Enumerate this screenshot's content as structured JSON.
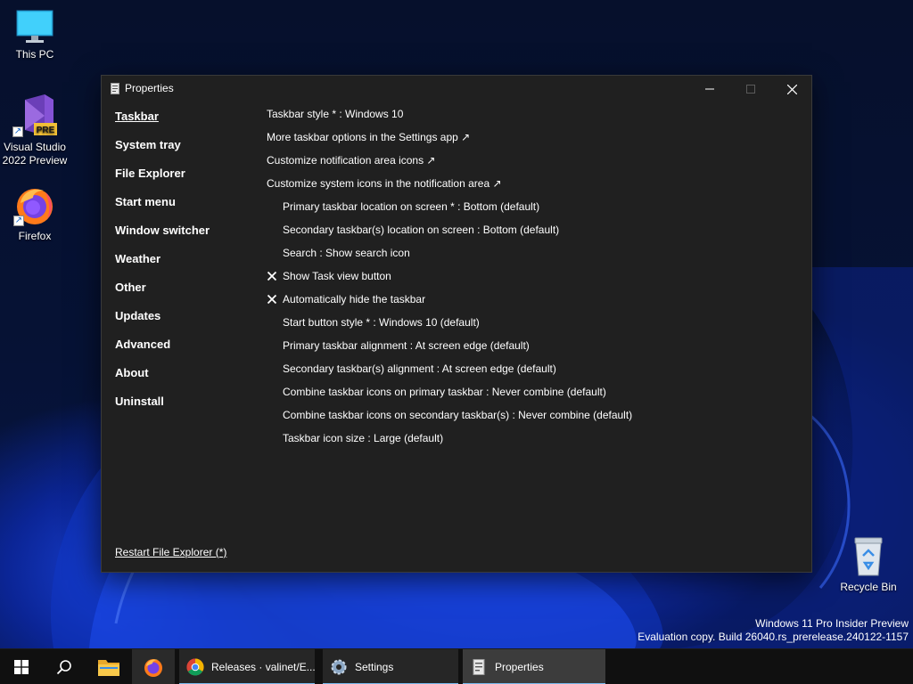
{
  "desktop": {
    "icons": [
      {
        "label": "This PC",
        "icon": "monitor-icon"
      },
      {
        "label": "Visual Studio 2022 Preview",
        "icon": "visual-studio-icon",
        "badge": "PRE"
      },
      {
        "label": "Firefox",
        "icon": "firefox-icon"
      },
      {
        "label": "Recycle Bin",
        "icon": "recycle-bin-icon"
      }
    ],
    "watermark": {
      "line1": "Windows 11 Pro Insider Preview",
      "line2": "Evaluation copy. Build 26040.rs_prerelease.240122-1157"
    }
  },
  "window": {
    "title": "Properties",
    "sidebar": {
      "items": [
        {
          "label": "Taskbar",
          "active": true
        },
        {
          "label": "System tray"
        },
        {
          "label": "File Explorer"
        },
        {
          "label": "Start menu"
        },
        {
          "label": "Window switcher"
        },
        {
          "label": "Weather"
        },
        {
          "label": "Other"
        },
        {
          "label": "Updates"
        },
        {
          "label": "Advanced"
        },
        {
          "label": "About"
        },
        {
          "label": "Uninstall"
        }
      ],
      "restart_label": "Restart File Explorer (*)"
    },
    "settings": [
      {
        "text": "Taskbar style * : Windows 10"
      },
      {
        "text": "More taskbar options in the Settings app ↗"
      },
      {
        "text": "Customize notification area icons ↗"
      },
      {
        "text": "Customize system icons in the notification area ↗"
      },
      {
        "text": "Primary taskbar location on screen * : Bottom (default)"
      },
      {
        "text": "Secondary taskbar(s) location on screen : Bottom (default)"
      },
      {
        "text": "Search : Show search icon"
      },
      {
        "text": "Show Task view button",
        "checked": true
      },
      {
        "text": "Automatically hide the taskbar",
        "checked": true
      },
      {
        "text": "Start button style * : Windows 10 (default)"
      },
      {
        "text": "Primary taskbar alignment : At screen edge (default)"
      },
      {
        "text": "Secondary taskbar(s) alignment : At screen edge (default)"
      },
      {
        "text": "Combine taskbar icons on primary taskbar : Never combine (default)"
      },
      {
        "text": "Combine taskbar icons on secondary taskbar(s) : Never combine (default)"
      },
      {
        "text": "Taskbar icon size : Large (default)"
      }
    ]
  },
  "taskbar": {
    "apps": [
      {
        "label": "Releases · valinet/E...",
        "icon": "chrome-icon"
      },
      {
        "label": "Settings",
        "icon": "settings-gear-icon"
      },
      {
        "label": "Properties",
        "icon": "properties-icon",
        "active": true
      }
    ],
    "accent_color": "#76b9ed"
  }
}
